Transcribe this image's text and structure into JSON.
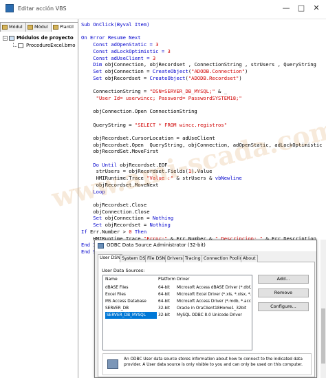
{
  "window": {
    "title": "Editar acción VBS",
    "minimize": "—",
    "maximize": "□",
    "close": "✕"
  },
  "left_panel": {
    "tabs": [
      "Módul",
      "Módul",
      "Plantil"
    ],
    "tree": {
      "root": "Módulos de proyecto",
      "child": "ProcedureExcel.bmo",
      "expander": "−"
    }
  },
  "code_lines": [
    [
      {
        "t": "Sub OnClick(Byval Item)",
        "c": "kw"
      }
    ],
    [],
    [
      {
        "t": "On Error Resume Next",
        "c": "kw"
      }
    ],
    [
      {
        "t": "    Const adOpenStatic = ",
        "c": "kw"
      },
      {
        "t": "3",
        "c": "st"
      }
    ],
    [
      {
        "t": "    Const adLockOptimistic = ",
        "c": "kw"
      },
      {
        "t": "3",
        "c": "st"
      }
    ],
    [
      {
        "t": "    Const adUseClient = ",
        "c": "kw"
      },
      {
        "t": "3",
        "c": "st"
      }
    ],
    [
      {
        "t": "    Dim",
        "c": "kw"
      },
      {
        "t": " objConnection, objRecordset , ConnectionString , strUsers , QueryString",
        "c": "fn"
      }
    ],
    [
      {
        "t": "    Set",
        "c": "kw"
      },
      {
        "t": " objConnection = ",
        "c": "fn"
      },
      {
        "t": "CreateObject",
        "c": "kw"
      },
      {
        "t": "(",
        "c": "fn"
      },
      {
        "t": "\"ADODB.Connection\"",
        "c": "st"
      },
      {
        "t": ")",
        "c": "fn"
      }
    ],
    [
      {
        "t": "    Set",
        "c": "kw"
      },
      {
        "t": " objRecordset = ",
        "c": "fn"
      },
      {
        "t": "CreateObject",
        "c": "kw"
      },
      {
        "t": "(",
        "c": "fn"
      },
      {
        "t": "\"ADODB.Recordset\"",
        "c": "st"
      },
      {
        "t": ")",
        "c": "fn"
      }
    ],
    [],
    [
      {
        "t": "    ConnectionString = ",
        "c": "fn"
      },
      {
        "t": "\"DSN=SERVER_DB_MYSQL;\"",
        "c": "st"
      },
      {
        "t": " & _",
        "c": "fn"
      }
    ],
    [
      {
        "t": "     \"User Id= userwincc; Password= PasswordSYSTEM18;\"",
        "c": "st"
      }
    ],
    [],
    [
      {
        "t": "    objConnection.Open ConnectionString",
        "c": "fn"
      }
    ],
    [],
    [
      {
        "t": "    QueryString = ",
        "c": "fn"
      },
      {
        "t": "\"SELECT * FROM wincc.registros\"",
        "c": "st"
      }
    ],
    [],
    [
      {
        "t": "    objRecordset.CursorLocation = adUseClient",
        "c": "fn"
      }
    ],
    [
      {
        "t": "    objRecordset.Open  QueryString, objConnection, adOpenStatic, adLockOptimistic",
        "c": "fn"
      }
    ],
    [
      {
        "t": "    objRecordSet.MoveFirst",
        "c": "fn"
      }
    ],
    [],
    [
      {
        "t": "    Do Until",
        "c": "kw"
      },
      {
        "t": " objRecordset.EOF",
        "c": "fn"
      }
    ],
    [
      {
        "t": "     strUsers = objRecordset.Fields(",
        "c": "fn"
      },
      {
        "t": "1",
        "c": "st"
      },
      {
        "t": ").Value",
        "c": "fn"
      }
    ],
    [
      {
        "t": "     HMIRuntime.Trace ",
        "c": "fn"
      },
      {
        "t": "\"Value :\"",
        "c": "st"
      },
      {
        "t": " & strUsers & ",
        "c": "fn"
      },
      {
        "t": "vbNewline",
        "c": "kw"
      }
    ],
    [
      {
        "t": "     objRecordset.MoveNext",
        "c": "fn"
      }
    ],
    [
      {
        "t": "    Loop",
        "c": "kw"
      }
    ],
    [],
    [
      {
        "t": "    objRecordset.Close",
        "c": "fn"
      }
    ],
    [
      {
        "t": "    objConnection.Close",
        "c": "fn"
      }
    ],
    [
      {
        "t": "    Set",
        "c": "kw"
      },
      {
        "t": " objConnection = ",
        "c": "fn"
      },
      {
        "t": "Nothing",
        "c": "kw"
      }
    ],
    [
      {
        "t": "    Set",
        "c": "kw"
      },
      {
        "t": " objRecordset = ",
        "c": "fn"
      },
      {
        "t": "Nothing",
        "c": "kw"
      }
    ],
    [
      {
        "t": "If",
        "c": "kw"
      },
      {
        "t": " Err.Number > ",
        "c": "fn"
      },
      {
        "t": "0",
        "c": "st"
      },
      {
        "t": " Then",
        "c": "kw"
      }
    ],
    [
      {
        "t": "    HMIRuntime.Trace ",
        "c": "fn"
      },
      {
        "t": "\"Error:\"",
        "c": "st"
      },
      {
        "t": " & Err.Number & ",
        "c": "fn"
      },
      {
        "t": "\" Descripcion: \"",
        "c": "st"
      },
      {
        "t": " & Err.Description",
        "c": "fn"
      }
    ],
    [
      {
        "t": "End If",
        "c": "kw"
      }
    ],
    [
      {
        "t": "End Sub",
        "c": "kw"
      }
    ]
  ],
  "watermark": "www.ami-scada.com",
  "dialog": {
    "title": "ODBC Data Source Administrator (32-bit)",
    "tabs": [
      "User DSN",
      "System DSN",
      "File DSN",
      "Drivers",
      "Tracing",
      "Connection Pooling",
      "About"
    ],
    "section_label": "User Data Sources:",
    "columns": [
      "Name",
      "Platform",
      "Driver"
    ],
    "rows": [
      {
        "name": "dBASE Files",
        "platform": "64-bit",
        "driver": "Microsoft Access dBASE Driver (*.dbf, *.ndx"
      },
      {
        "name": "Excel Files",
        "platform": "64-bit",
        "driver": "Microsoft Excel Driver (*.xls, *.xlsx, *.xlsm,"
      },
      {
        "name": "MS Access Database",
        "platform": "64-bit",
        "driver": "Microsoft Access Driver (*.mdb, *.accdb)"
      },
      {
        "name": "SERVER_DB",
        "platform": "32-bit",
        "driver": "Oracle in OraClient18Home1_32bit"
      },
      {
        "name": "SERVER_DB_MYSQL",
        "platform": "32-bit",
        "driver": "MySQL ODBC 8.0 Unicode Driver"
      }
    ],
    "buttons": {
      "add": "Add...",
      "remove": "Remove",
      "configure": "Configure..."
    },
    "info_text": "An ODBC User data source stores information about how to connect to the indicated data provider.  A User data source is only visible to you and can only be used on this computer."
  },
  "colors": {
    "keyword": "#0000cc",
    "string": "#d00000",
    "selection": "#0078d7"
  }
}
